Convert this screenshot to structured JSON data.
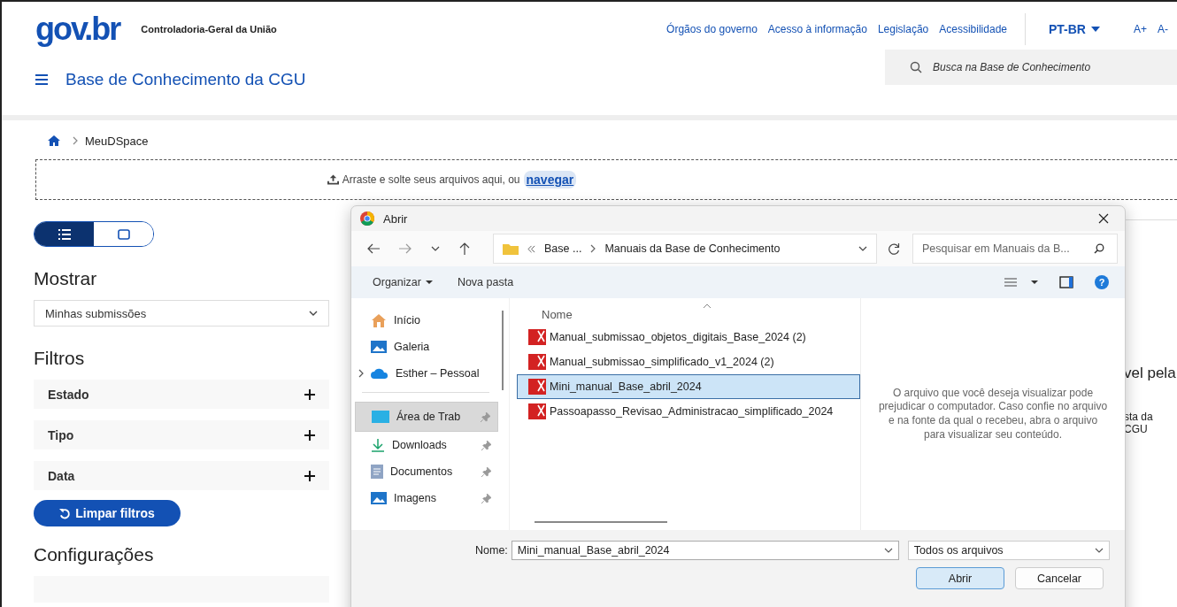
{
  "header": {
    "logo": "gov.br",
    "agency": "Controladoria-Geral da União",
    "links": [
      "Órgãos do governo",
      "Acesso à informação",
      "Legislação",
      "Acessibilidade"
    ],
    "language": "PT-BR",
    "font_size": [
      "A+",
      "A-"
    ],
    "site_title": "Base de Conhecimento da CGU",
    "search": {
      "placeholder": "Busca na Base de Conhecimento"
    }
  },
  "breadcrumb": [
    "MeuDSpace"
  ],
  "dropzone": {
    "text": "Arraste e solte seus arquivos aqui, ou",
    "link": "navegar"
  },
  "view_toggle": [
    {
      "kind": "list",
      "selected": true
    },
    {
      "kind": "grid",
      "selected": false
    }
  ],
  "sidebar": {
    "show_heading": "Mostrar",
    "show_select": "Minhas submissões",
    "filters_heading": "Filtros",
    "filters": [
      {
        "label": "Estado",
        "expanded": false
      },
      {
        "label": "Tipo",
        "expanded": false
      },
      {
        "label": "Data",
        "expanded": false
      }
    ],
    "clear_button": "Limpar filtros",
    "settings_heading": "Configurações"
  },
  "background_text": [
    "vel pela",
    "sta da CGU"
  ],
  "dialog": {
    "title": "Abrir",
    "path": [
      "Base ...",
      "Manuais da Base de Conhecimento"
    ],
    "search_placeholder": "Pesquisar em Manuais da B...",
    "toolbar": [
      "Organizar",
      "Nova pasta"
    ],
    "help": "?",
    "nav": [
      {
        "label": "Início",
        "kind": "home",
        "pinned": false,
        "expandable": false,
        "selected": false
      },
      {
        "label": "Galeria",
        "kind": "gallery",
        "pinned": false,
        "expandable": false,
        "selected": false
      },
      {
        "label": "Esther – Pessoal",
        "kind": "cloud",
        "pinned": false,
        "expandable": true,
        "selected": false
      },
      {
        "label": "Área de Trab",
        "kind": "desktop",
        "pinned": true,
        "expandable": false,
        "selected": true
      },
      {
        "label": "Downloads",
        "kind": "download",
        "pinned": true,
        "expandable": false,
        "selected": false
      },
      {
        "label": "Documentos",
        "kind": "documents",
        "pinned": true,
        "expandable": false,
        "selected": false
      },
      {
        "label": "Imagens",
        "kind": "gallery",
        "pinned": true,
        "expandable": false,
        "selected": false
      }
    ],
    "column": "Nome",
    "files": [
      {
        "name": "Manual_submissao_objetos_digitais_Base_2024 (2)",
        "selected": false
      },
      {
        "name": "Manual_submissao_simplificado_v1_2024 (2)",
        "selected": false
      },
      {
        "name": "Mini_manual_Base_abril_2024",
        "selected": true
      },
      {
        "name": "Passoapasso_Revisao_Administracao_simplificado_2024",
        "selected": false
      }
    ],
    "preview": "O arquivo que você deseja visualizar pode prejudicar o computador. Caso confie no arquivo e na fonte da qual o recebeu, abra o arquivo para visualizar seu conteúdo.",
    "filename_label": "Nome:",
    "filename": "Mini_manual_Base_abril_2024",
    "filetype": "Todos os arquivos",
    "buttons": [
      "Abrir",
      "Cancelar"
    ]
  }
}
